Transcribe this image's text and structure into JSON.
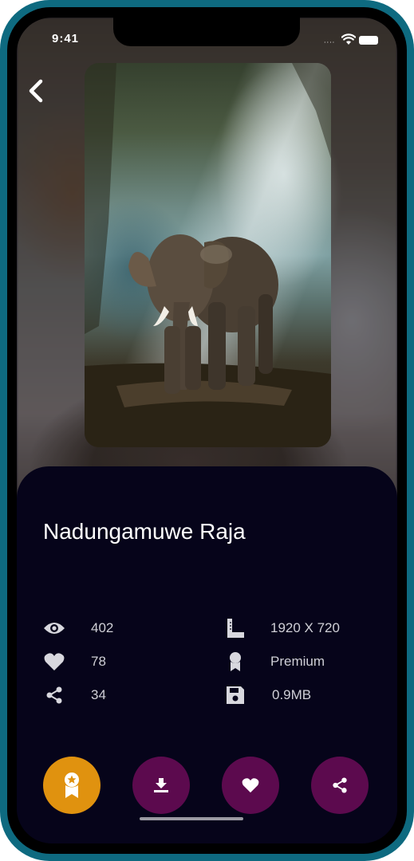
{
  "status_bar": {
    "time": "9:41",
    "signal": "····"
  },
  "wallpaper": {
    "title": "Nadungamuwe Raja",
    "stats_left": [
      {
        "icon": "eye-icon",
        "value": "402"
      },
      {
        "icon": "heart-icon",
        "value": "78"
      },
      {
        "icon": "share-icon",
        "value": "34"
      }
    ],
    "stats_right": [
      {
        "icon": "ruler-icon",
        "value": "1920 X 720"
      },
      {
        "icon": "award-icon",
        "value": "Premium"
      },
      {
        "icon": "save-icon",
        "value": "0.9MB"
      }
    ]
  },
  "actions": [
    {
      "name": "premium-button",
      "icon": "award-icon",
      "color": "#E0920F"
    },
    {
      "name": "download-button",
      "icon": "download-icon",
      "color": "#5C0A4E"
    },
    {
      "name": "favorite-button",
      "icon": "heart-icon",
      "color": "#5C0A4E"
    },
    {
      "name": "share-button",
      "icon": "share-icon",
      "color": "#5C0A4E"
    }
  ],
  "colors": {
    "panel_background": "#06041A",
    "frame": "#0E6A80",
    "text_secondary": "#CFCFD6",
    "icon": "#D8D8DE"
  }
}
